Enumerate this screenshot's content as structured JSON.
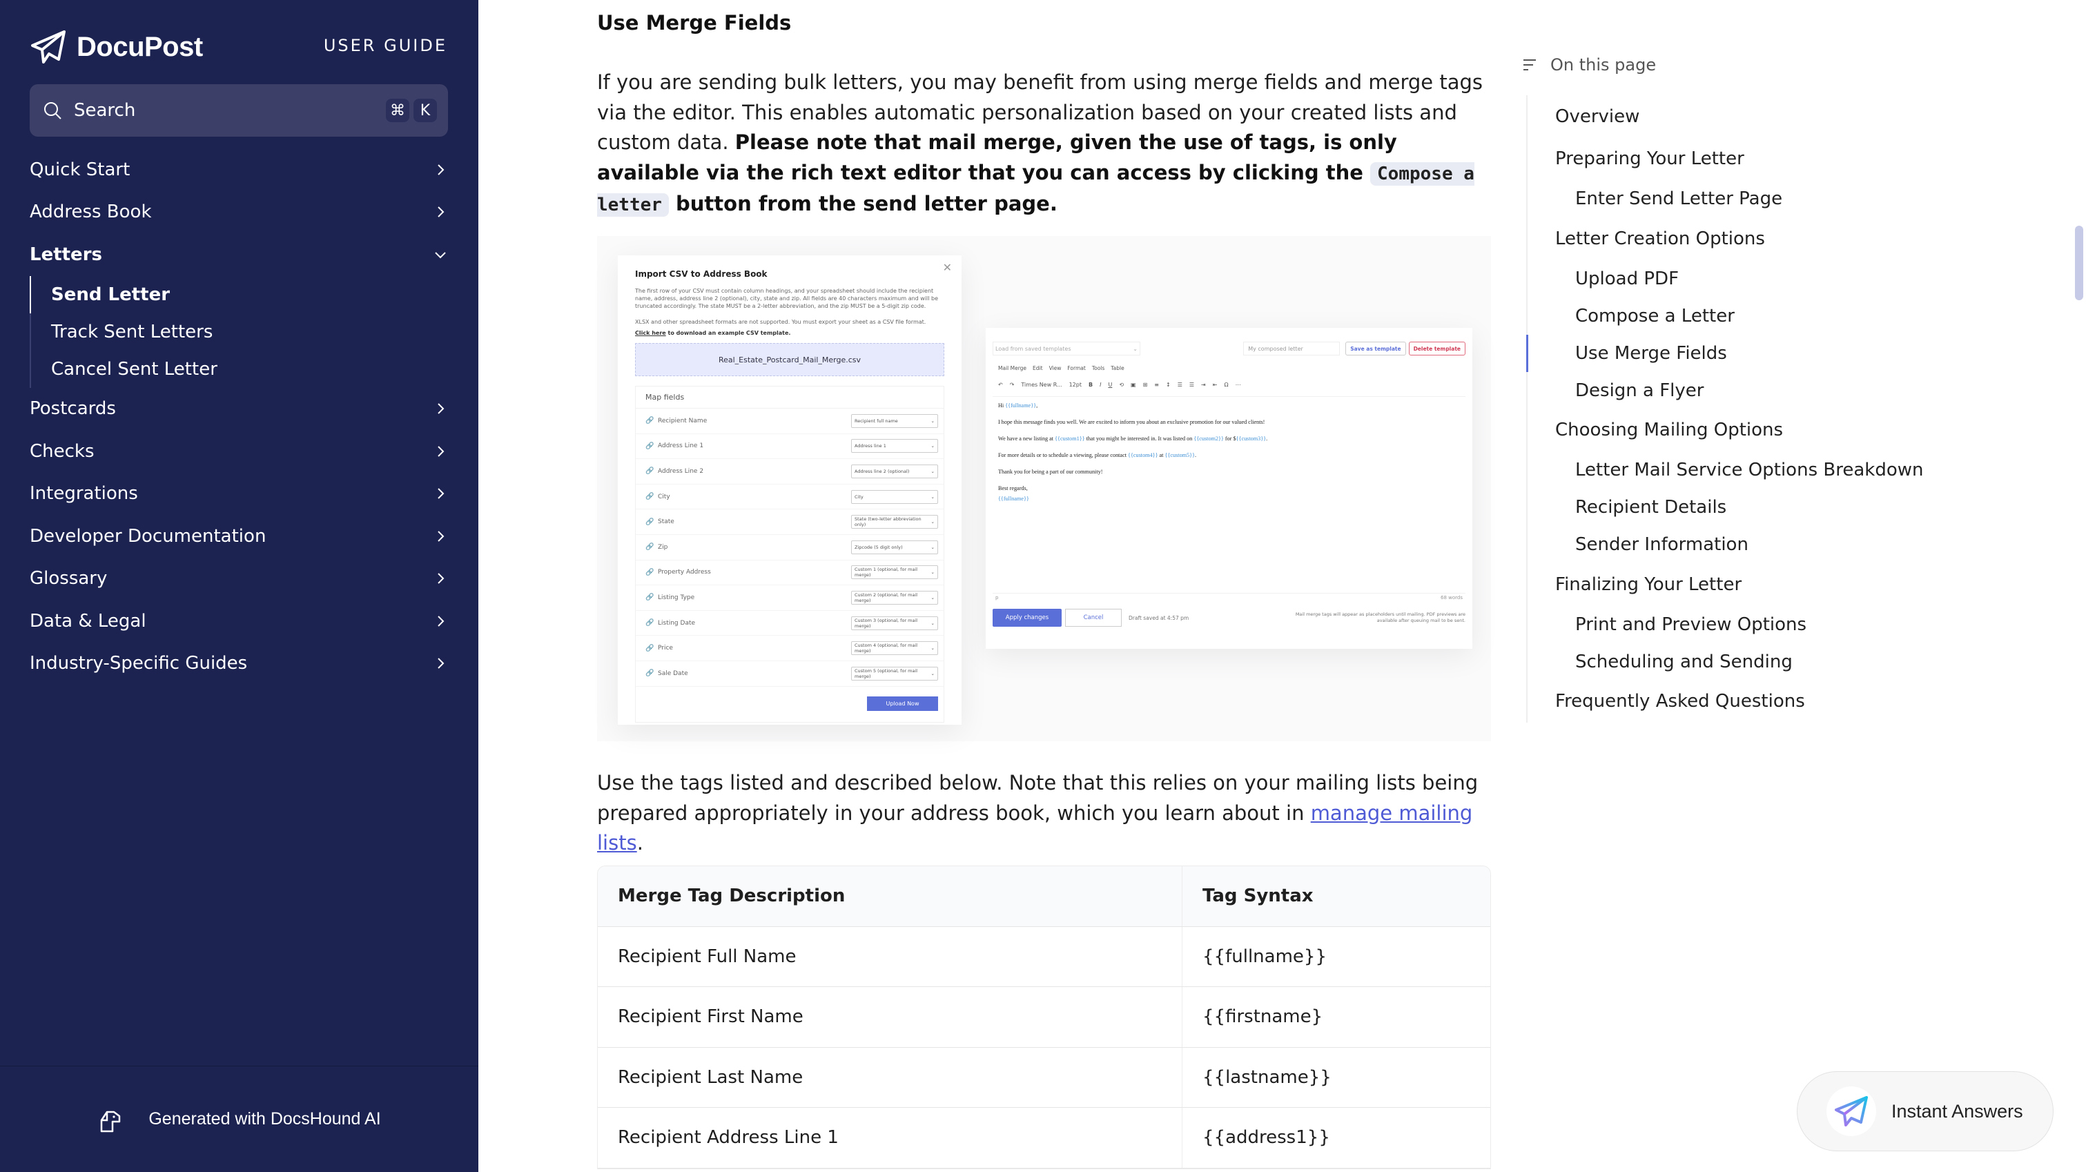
{
  "sidebar": {
    "brand": "DocuPost",
    "section_label": "USER GUIDE",
    "search": {
      "label": "Search",
      "shortcut_keys": [
        "⌘",
        "K"
      ]
    },
    "items": [
      {
        "label": "Quick Start",
        "icon": "chevron-right-icon"
      },
      {
        "label": "Address Book",
        "icon": "chevron-right-icon"
      },
      {
        "label": "Letters",
        "icon": "chevron-down-icon",
        "expanded": true,
        "children": [
          {
            "label": "Send Letter",
            "active": true
          },
          {
            "label": "Track Sent Letters"
          },
          {
            "label": "Cancel Sent Letter"
          }
        ]
      },
      {
        "label": "Postcards",
        "icon": "chevron-right-icon"
      },
      {
        "label": "Checks",
        "icon": "chevron-right-icon"
      },
      {
        "label": "Integrations",
        "icon": "chevron-right-icon"
      },
      {
        "label": "Developer Documentation",
        "icon": "chevron-right-icon"
      },
      {
        "label": "Glossary",
        "icon": "chevron-right-icon"
      },
      {
        "label": "Data & Legal",
        "icon": "chevron-right-icon"
      },
      {
        "label": "Industry-Specific Guides",
        "icon": "chevron-right-icon"
      }
    ],
    "footer": "Generated with DocsHound AI"
  },
  "main": {
    "heading": "Use Merge Fields",
    "intro": {
      "plain": "If you are sending bulk letters, you may benefit from using merge fields and merge tags via the editor. This enables automatic personalization based on your created lists and custom data. ",
      "bold_before_code": "Please note that mail merge, given the use of tags, is only available via the rich text editor that you can access by clicking the ",
      "code": "Compose a letter",
      "bold_after_code": " button from the send letter page."
    },
    "figure": {
      "csv_modal": {
        "title": "Import CSV to Address Book",
        "text1": "The first row of your CSV must contain column headings, and your spreadsheet should include the recipient name, address, address line 2 (optional), city, state and zip.  All fields are 40 characters maximum and will be truncated accordingly. The state MUST be a 2-letter abbreviation, and the zip MUST be a 5-digit zip code.",
        "text2": "XLSX and other spreadsheet formats are not supported. You must export your sheet as a CSV file format.",
        "link": "Click here",
        "link_rest": " to download an example CSV template.",
        "file_name": "Real_Estate_Postcard_Mail_Merge.csv",
        "map_header": "Map fields",
        "rows": [
          {
            "field": "Recipient Name",
            "mapped": "Recipient full name"
          },
          {
            "field": "Address Line 1",
            "mapped": "Address line 1"
          },
          {
            "field": "Address Line 2",
            "mapped": "Address line 2 (optional)"
          },
          {
            "field": "City",
            "mapped": "City"
          },
          {
            "field": "State",
            "mapped": "State (two-letter abbreviation only)"
          },
          {
            "field": "Zip",
            "mapped": "Zipcode (5 digit only)"
          },
          {
            "field": "Property Address",
            "mapped": "Custom 1 (optional, for mail merge)"
          },
          {
            "field": "Listing Type",
            "mapped": "Custom 2 (optional, for mail merge)"
          },
          {
            "field": "Listing Date",
            "mapped": "Custom 3 (optional, for mail merge)"
          },
          {
            "field": "Price",
            "mapped": "Custom 4 (optional, for mail merge)"
          },
          {
            "field": "Sale Date",
            "mapped": "Custom 5 (optional, for mail merge)"
          }
        ],
        "upload_button": "Upload Now"
      },
      "editor": {
        "template_select": "Load from saved templates",
        "template_name": "My composed letter",
        "save_template": "Save as template",
        "delete_template": "Delete template",
        "menu": [
          "Mail Merge",
          "Edit",
          "View",
          "Format",
          "Tools",
          "Table"
        ],
        "font": "Times New R...",
        "size": "12pt",
        "body": {
          "greeting_pre": "Hi ",
          "greeting_tag": "{{fullname}}",
          "greeting_post": ",",
          "line1": "I hope this message finds you well. We are excited to inform you about an exclusive promotion for our valued clients!",
          "line2_a": "We have a new listing at ",
          "line2_tag1": "{{custom1}}",
          "line2_b": " that you might be interested in. It was listed on ",
          "line2_tag2": "{{custom2}}",
          "line2_c": " for $",
          "line2_tag3": "{{custom3}}",
          "line2_d": ".",
          "line3_a": "For more details or to schedule a viewing, please contact ",
          "line3_tag1": "{{custom4}}",
          "line3_b": " at ",
          "line3_tag2": "{{custom5}}",
          "line3_c": ".",
          "line4": "Thank you for being a part of our community!",
          "closing": "Best regards,",
          "signature_tag": "{{fullname}}"
        },
        "status_left": "p",
        "word_count": "68 words",
        "apply": "Apply changes",
        "cancel": "Cancel",
        "draft": "Draft saved at 4:57 pm",
        "note": "Mail merge tags will appear as placeholders until mailing.  PDF previews are available after queuing mail to be sent."
      }
    },
    "tags_intro": "Use the tags listed and described below. Note that this relies on your mailing lists being prepared appropriately in your address book, which you learn about in ",
    "tags_link": "manage mailing lists",
    "tags_intro_end": ".",
    "table": {
      "headers": [
        "Merge Tag Description",
        "Tag Syntax"
      ],
      "rows": [
        [
          "Recipient Full Name",
          "{{fullname}}"
        ],
        [
          "Recipient First Name",
          "{{firstname}"
        ],
        [
          "Recipient Last Name",
          "{{lastname}}"
        ],
        [
          "Recipient Address Line 1",
          "{{address1}}"
        ]
      ]
    }
  },
  "toc": {
    "title": "On this page",
    "items": [
      {
        "label": "Overview",
        "level": 1
      },
      {
        "label": "Preparing Your Letter",
        "level": 1
      },
      {
        "label": "Enter Send Letter Page",
        "level": 2
      },
      {
        "label": "Letter Creation Options",
        "level": 1
      },
      {
        "label": "Upload PDF",
        "level": 2
      },
      {
        "label": "Compose a Letter",
        "level": 2
      },
      {
        "label": "Use Merge Fields",
        "level": 2,
        "active": true
      },
      {
        "label": "Design a Flyer",
        "level": 2
      },
      {
        "label": "Choosing Mailing Options",
        "level": 1
      },
      {
        "label": "Letter Mail Service Options Breakdown",
        "level": 2
      },
      {
        "label": "Recipient Details",
        "level": 2
      },
      {
        "label": "Sender Information",
        "level": 2
      },
      {
        "label": "Finalizing Your Letter",
        "level": 1
      },
      {
        "label": "Print and Preview Options",
        "level": 2
      },
      {
        "label": "Scheduling and Sending",
        "level": 2
      },
      {
        "label": "Frequently Asked Questions",
        "level": 1
      }
    ]
  },
  "instant_answers": {
    "label": "Instant Answers"
  },
  "colors": {
    "sidebar_bg": "#1c2350",
    "accent": "#5b6fd8",
    "link": "#4f5bd5"
  }
}
